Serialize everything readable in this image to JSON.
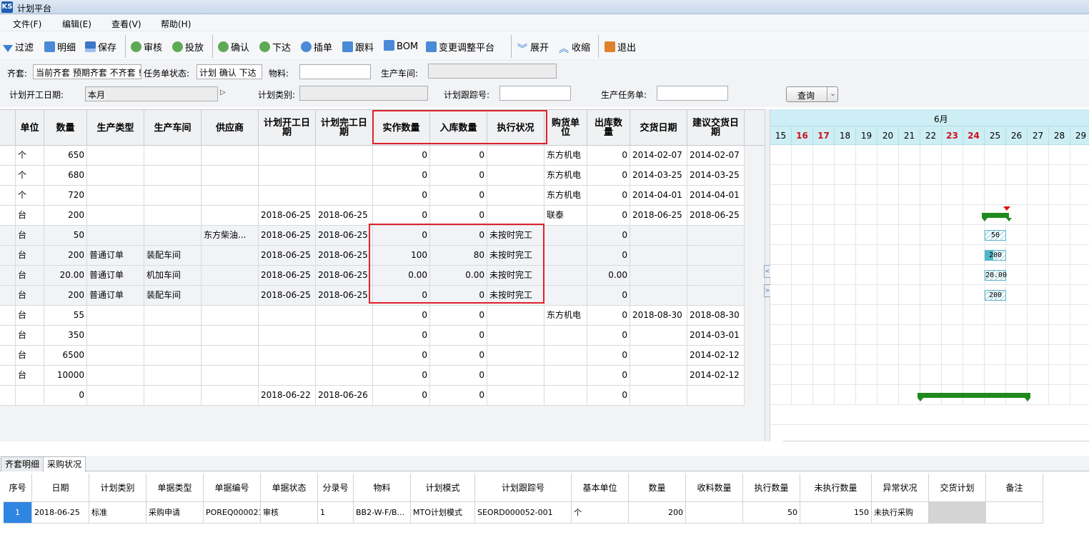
{
  "window": {
    "title": "计划平台",
    "app_icon": "KS"
  },
  "menu": [
    "文件(F)",
    "编辑(E)",
    "查看(V)",
    "帮助(H)"
  ],
  "toolbar": {
    "filter": "过滤",
    "detail": "明细",
    "save": "保存",
    "audit": "审核",
    "release": "投放",
    "confirm": "确认",
    "issue": "下达",
    "insert": "插单",
    "follow": "跟料",
    "bom": "BOM",
    "change_platform": "变更调整平台",
    "expand": "展开",
    "collapse": "收缩",
    "exit": "退出"
  },
  "filters": {
    "kit_label": "齐套:",
    "kit_value": "当前齐套 预期齐套 不齐套 !",
    "task_status_label": "任务单状态:",
    "task_status_value": "计划 确认 下达",
    "material_label": "物料:",
    "material_value": "",
    "workshop_label": "生产车间:",
    "workshop_value": "",
    "plan_start_label": "计划开工日期:",
    "plan_start_value": "本月",
    "plan_type_label": "计划类别:",
    "plan_type_value": "",
    "track_no_label": "计划跟踪号:",
    "track_no_value": "",
    "task_label": "生产任务单:",
    "task_value": "",
    "query_button": "查询"
  },
  "grid": {
    "headers": [
      "单位",
      "数量",
      "生产类型",
      "生产车间",
      "供应商",
      "计划开工日期",
      "计划完工日期",
      "实作数量",
      "入库数量",
      "执行状况",
      "购货单位",
      "出库数量",
      "交货日期",
      "建议交货日期"
    ],
    "rows": [
      [
        "个",
        "650",
        "",
        "",
        "",
        "",
        "",
        "0",
        "0",
        "",
        "东方机电",
        "0",
        "2014-02-07",
        "2014-02-07"
      ],
      [
        "个",
        "680",
        "",
        "",
        "",
        "",
        "",
        "0",
        "0",
        "",
        "东方机电",
        "0",
        "2014-03-25",
        "2014-03-25"
      ],
      [
        "个",
        "720",
        "",
        "",
        "",
        "",
        "",
        "0",
        "0",
        "",
        "东方机电",
        "0",
        "2014-04-01",
        "2014-04-01"
      ],
      [
        "台",
        "200",
        "",
        "",
        "",
        "2018-06-25",
        "2018-06-25",
        "0",
        "0",
        "",
        "联泰",
        "0",
        "2018-06-25",
        "2018-06-25"
      ],
      [
        "台",
        "50",
        "",
        "",
        "东方柴油...",
        "2018-06-25",
        "2018-06-25",
        "0",
        "0",
        "未按时完工",
        "",
        "0",
        "",
        ""
      ],
      [
        "台",
        "200",
        "普通订单",
        "装配车间",
        "",
        "2018-06-25",
        "2018-06-25",
        "100",
        "80",
        "未按时完工",
        "",
        "0",
        "",
        ""
      ],
      [
        "台",
        "20.00",
        "普通订单",
        "机加车间",
        "",
        "2018-06-25",
        "2018-06-25",
        "0.00",
        "0.00",
        "未按时完工",
        "",
        "0.00",
        "",
        ""
      ],
      [
        "台",
        "200",
        "普通订单",
        "装配车间",
        "",
        "2018-06-25",
        "2018-06-25",
        "0",
        "0",
        "未按时完工",
        "",
        "0",
        "",
        ""
      ],
      [
        "台",
        "55",
        "",
        "",
        "",
        "",
        "",
        "0",
        "0",
        "",
        "东方机电",
        "0",
        "2018-08-30",
        "2018-08-30"
      ],
      [
        "台",
        "350",
        "",
        "",
        "",
        "",
        "",
        "0",
        "0",
        "",
        "",
        "0",
        "",
        "2014-03-01"
      ],
      [
        "台",
        "6500",
        "",
        "",
        "",
        "",
        "",
        "0",
        "0",
        "",
        "",
        "0",
        "",
        "2014-02-12"
      ],
      [
        "台",
        "10000",
        "",
        "",
        "",
        "",
        "",
        "0",
        "0",
        "",
        "",
        "0",
        "",
        "2014-02-12"
      ],
      [
        "",
        "0",
        "",
        "",
        "",
        "2018-06-22",
        "2018-06-26",
        "0",
        "0",
        "",
        "",
        "0",
        "",
        ""
      ]
    ]
  },
  "gantt": {
    "month": "6月",
    "days": [
      "15",
      "16",
      "17",
      "18",
      "19",
      "20",
      "21",
      "22",
      "23",
      "24",
      "25",
      "26",
      "27",
      "28",
      "29"
    ],
    "red_days": [
      "16",
      "17",
      "23",
      "24"
    ],
    "boxes": [
      {
        "row": 4,
        "label": "50",
        "progress": 0
      },
      {
        "row": 5,
        "label": "200",
        "progress": 0.4
      },
      {
        "row": 6,
        "label": "20.00",
        "progress": 0
      },
      {
        "row": 7,
        "label": "200",
        "progress": 0
      }
    ]
  },
  "tabs": [
    "齐套明细",
    "采购状况"
  ],
  "purchase": {
    "headers": [
      "序号",
      "日期",
      "计划类别",
      "单据类型",
      "单据编号",
      "单据状态",
      "分录号",
      "物料",
      "计划模式",
      "计划跟踪号",
      "基本单位",
      "数量",
      "收料数量",
      "执行数量",
      "未执行数量",
      "异常状况",
      "交货计划",
      "备注"
    ],
    "row": [
      "1",
      "2018-06-25",
      "标准",
      "采购申请",
      "POREQ000021",
      "审核",
      "1",
      "BB2-W-F/B...",
      "MTO计划模式",
      "SEORD000052-001",
      "个",
      "200",
      "",
      "50",
      "150",
      "未执行采购",
      "",
      ""
    ]
  },
  "colors": {
    "highlight_border": "#e0202a",
    "gantt_header": "#cdeef4",
    "gantt_bar": "#1e8a1e",
    "weekend": "#d0101a"
  }
}
